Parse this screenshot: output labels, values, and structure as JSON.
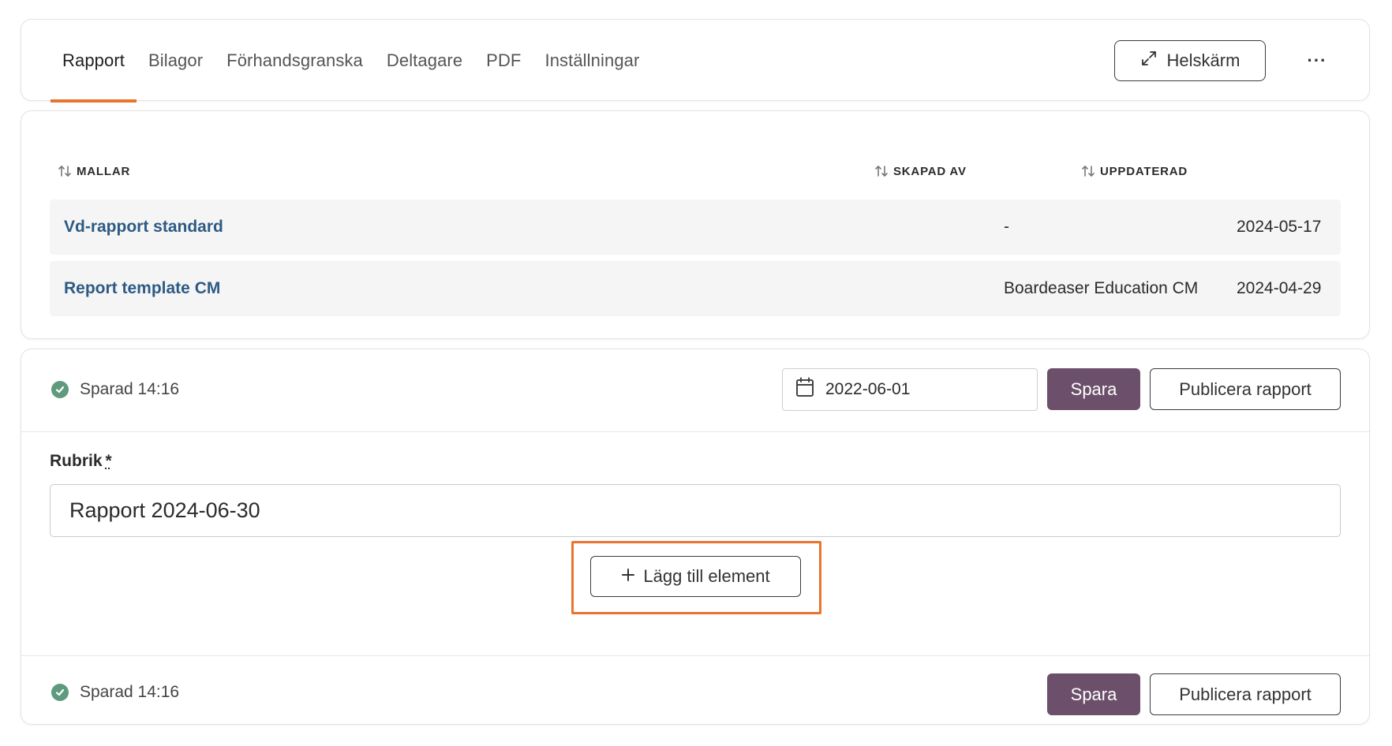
{
  "tabs": [
    {
      "label": "Rapport",
      "active": true
    },
    {
      "label": "Bilagor",
      "active": false
    },
    {
      "label": "Förhandsgranska",
      "active": false
    },
    {
      "label": "Deltagare",
      "active": false
    },
    {
      "label": "PDF",
      "active": false
    },
    {
      "label": "Inställningar",
      "active": false
    }
  ],
  "toolbar": {
    "fullscreen_label": "Helskärm",
    "more_label": "···"
  },
  "templates": {
    "columns": {
      "name": "MALLAR",
      "created_by": "SKAPAD AV",
      "updated": "UPPDATERAD"
    },
    "rows": [
      {
        "name": "Vd-rapport standard",
        "created_by": "-",
        "updated": "2024-05-17"
      },
      {
        "name": "Report template CM",
        "created_by": "Boardeaser Education CM",
        "updated": "2024-04-29"
      }
    ]
  },
  "editor": {
    "saved_status_top": "Sparad 14:16",
    "date_value": "2022-06-01",
    "save_label": "Spara",
    "publish_label": "Publicera rapport",
    "title_label": "Rubrik",
    "title_required_marker": "*",
    "title_value": "Rapport 2024-06-30",
    "add_element_label": "Lägg till element",
    "saved_status_bottom": "Sparad 14:16"
  },
  "colors": {
    "accent": "#e8742e",
    "primary_button": "#6c4f6a",
    "link": "#2d5a84",
    "success": "#5e9a7d"
  }
}
